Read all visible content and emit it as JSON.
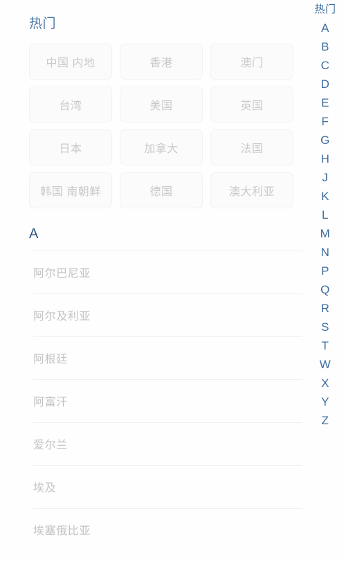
{
  "hot_section": {
    "title": "热门",
    "tags": [
      "中国 内地",
      "香港",
      "澳门",
      "台湾",
      "美国",
      "英国",
      "日本",
      "加拿大",
      "法国",
      "韩国 南朝鲜",
      "德国",
      "澳大利亚"
    ]
  },
  "letter_section": {
    "header": "A",
    "countries": [
      "阿尔巴尼亚",
      "阿尔及利亚",
      "阿根廷",
      "阿富汗",
      "爱尔兰",
      "埃及",
      "埃塞俄比亚"
    ]
  },
  "index_rail": {
    "items": [
      "热门",
      "A",
      "B",
      "C",
      "D",
      "E",
      "F",
      "G",
      "H",
      "J",
      "K",
      "L",
      "M",
      "N",
      "P",
      "Q",
      "R",
      "S",
      "T",
      "W",
      "X",
      "Y",
      "Z"
    ]
  },
  "colors": {
    "hot_title": "#4c77a3",
    "section_header": "#2c5480",
    "index_letter": "#3e6d9e",
    "tag_text": "#c9c9c9",
    "tag_bg": "#fbfbfb",
    "tag_border": "#f2f2f2",
    "list_text": "#c2c2c2",
    "divider": "#f0f0f0",
    "page_bg": "#fefefe"
  }
}
